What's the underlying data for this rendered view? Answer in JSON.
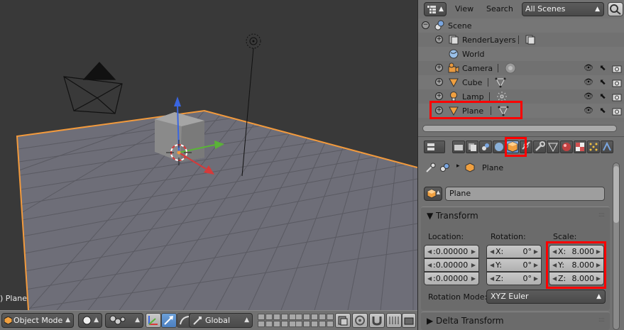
{
  "viewport": {
    "active_object_label": ") Plane",
    "header": {
      "mode": "Object Mode",
      "orientation": "Global"
    }
  },
  "outliner": {
    "menu": [
      "View",
      "Search"
    ],
    "display_mode": "All Scenes",
    "items": [
      {
        "label": "Scene",
        "icon": "scene-icon"
      },
      {
        "label": "RenderLayers",
        "icon": "render-layers-icon"
      },
      {
        "label": "World",
        "icon": "world-icon"
      },
      {
        "label": "Camera",
        "icon": "camera-icon"
      },
      {
        "label": "Cube",
        "icon": "mesh-icon"
      },
      {
        "label": "Lamp",
        "icon": "lamp-icon"
      },
      {
        "label": "Plane",
        "icon": "mesh-icon"
      }
    ]
  },
  "properties": {
    "context_object": "Plane",
    "object_name": "Plane",
    "transform": {
      "title": "Transform",
      "location_label": "Location:",
      "rotation_label": "Rotation:",
      "scale_label": "Scale:",
      "location": [
        ":0.00000",
        ":0.00000",
        ":0.00000"
      ],
      "rotation": [
        {
          "axis": "X:",
          "value": "0°"
        },
        {
          "axis": "Y:",
          "value": "0°"
        },
        {
          "axis": "Z:",
          "value": "0°"
        }
      ],
      "scale": [
        {
          "axis": "X:",
          "value": "8.000"
        },
        {
          "axis": "Y:",
          "value": "8.000"
        },
        {
          "axis": "Z:",
          "value": "8.000"
        }
      ],
      "rotation_mode_label": "Rotation Mode:",
      "rotation_mode": "XYZ Euler"
    },
    "delta_transform_title": "Delta Transform"
  },
  "colors": {
    "highlight": "#ff0000",
    "selection_outline": "#f29a3d",
    "axis_x": "#d63a3a",
    "axis_y": "#5ab337",
    "axis_z": "#3a66e0"
  }
}
